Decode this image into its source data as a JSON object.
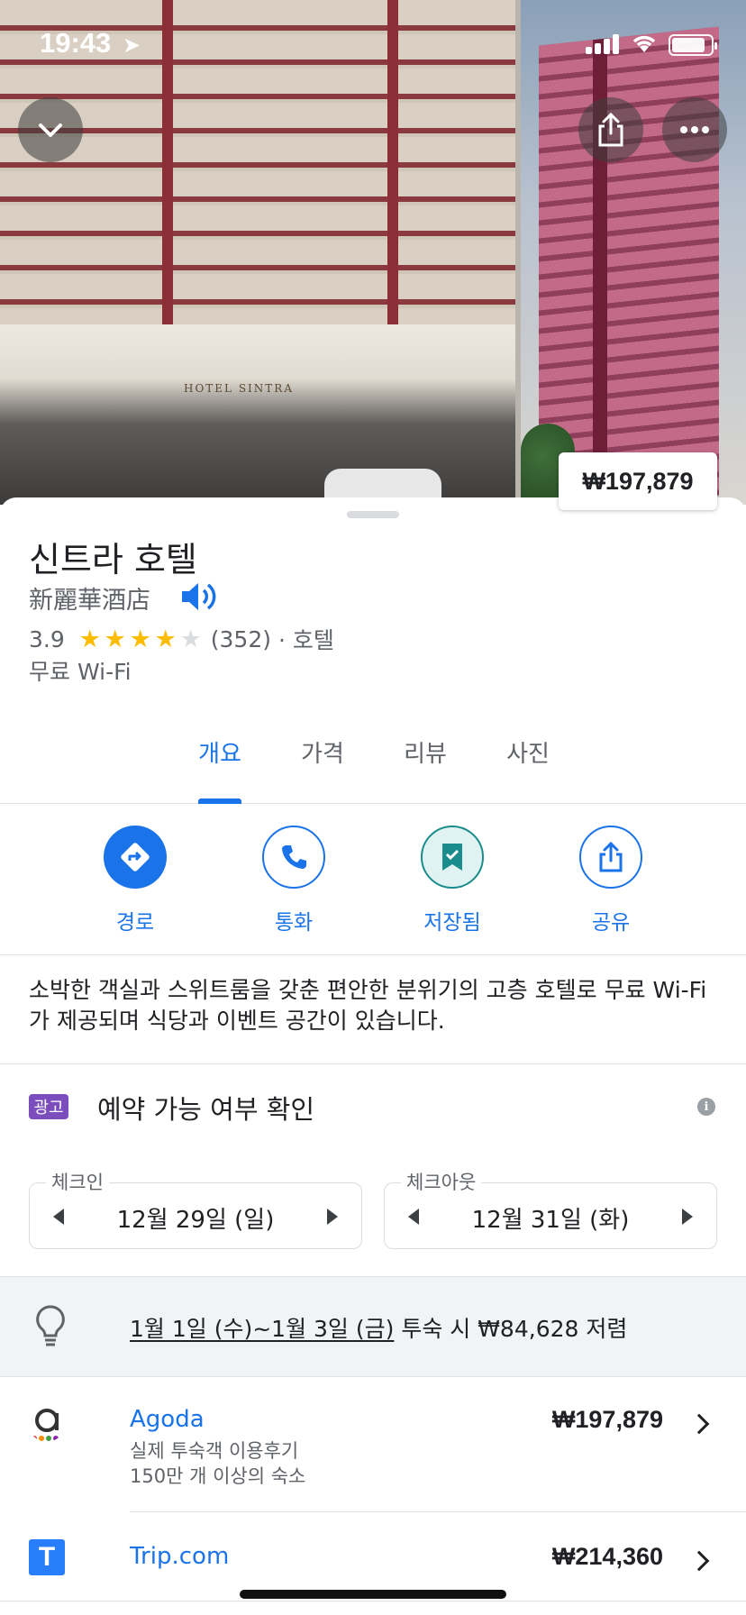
{
  "status_bar": {
    "time": "19:43"
  },
  "hero": {
    "sign_text": "HOTEL SINTRA",
    "price_chip": "₩197,879"
  },
  "place": {
    "title": "신트라 호텔",
    "native_name": "新麗華酒店",
    "rating": "3.9",
    "rating_stars": 3.9,
    "review_count": "(352)",
    "category": "· 호텔",
    "amenity": "무료 Wi-Fi"
  },
  "tabs": [
    {
      "label": "개요",
      "active": true
    },
    {
      "label": "가격",
      "active": false
    },
    {
      "label": "리뷰",
      "active": false
    },
    {
      "label": "사진",
      "active": false
    }
  ],
  "actions": [
    {
      "label": "경로",
      "icon": "directions-icon"
    },
    {
      "label": "통화",
      "icon": "phone-icon"
    },
    {
      "label": "저장됨",
      "icon": "bookmark-icon"
    },
    {
      "label": "공유",
      "icon": "share-icon"
    }
  ],
  "description": "소박한 객실과 스위트룸을 갖춘 편안한 분위기의 고층 호텔로 무료 Wi-Fi가 제공되며 식당과 이벤트 공간이 있습니다.",
  "availability": {
    "ad_badge": "광고",
    "title": "예약 가능 여부 확인",
    "checkin_label": "체크인",
    "checkin_value": "12월 29일 (일)",
    "checkout_label": "체크아웃",
    "checkout_value": "12월 31일 (화)"
  },
  "tip": {
    "dates": "1월 1일 (수)~1월 3일 (금)",
    "rest": " 투숙 시 ₩84,628 저렴"
  },
  "providers": [
    {
      "name": "Agoda",
      "sub1": "실제 투숙객 이용후기",
      "sub2": "150만 개 이상의 숙소",
      "price": "₩197,879"
    },
    {
      "name": "Trip.com",
      "logo_letter": "T",
      "price": "₩214,360"
    }
  ],
  "colors": {
    "accent": "#1a73e8",
    "star": "#fbbc04",
    "ad": "#7c4dbd",
    "trip": "#287dfa"
  }
}
